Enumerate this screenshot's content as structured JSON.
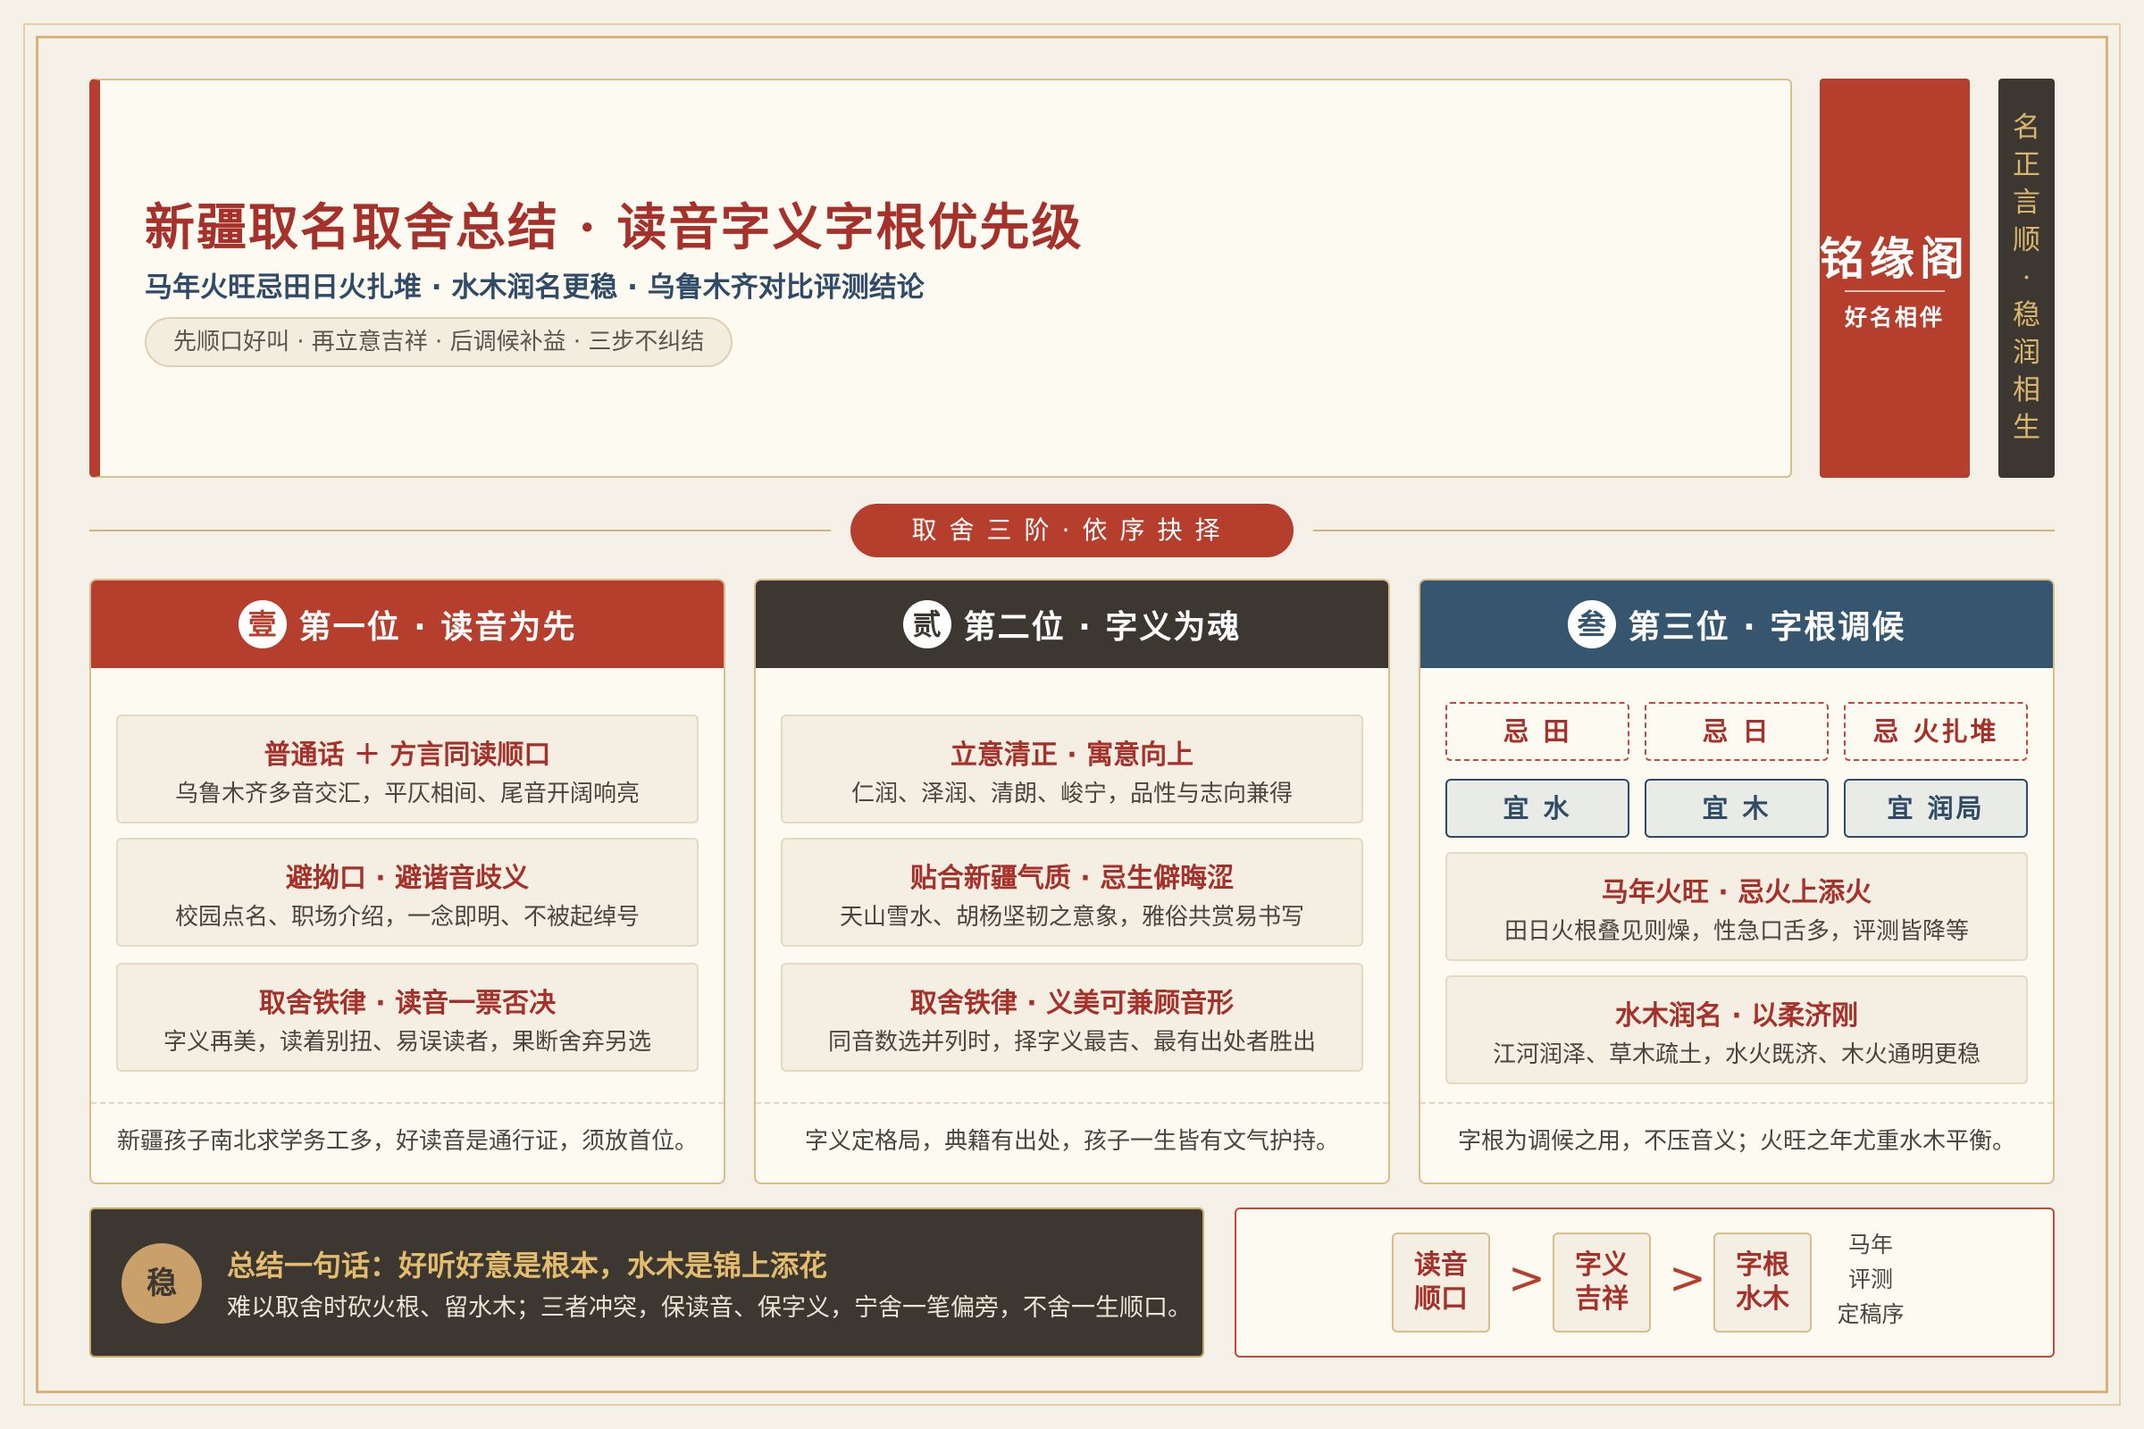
{
  "header": {
    "title": "新疆取名取舍总结 · 读音字义字根优先级",
    "subtitle": "马年火旺忌田日火扎堆 · 水木润名更稳 · 乌鲁木齐对比评测结论",
    "pill": "先顺口好叫 · 再立意吉祥 · 后调候补益 · 三步不纠结"
  },
  "seal": {
    "name": "铭缘阁",
    "slogan": "好名相伴"
  },
  "vertical_banner": [
    "名",
    "正",
    "言",
    "顺",
    "·",
    "稳",
    "润",
    "相",
    "生"
  ],
  "section": {
    "label": "取舍三阶·依序抉择"
  },
  "columns": [
    {
      "badge": "壹",
      "title": "第一位 · 读音为先",
      "color": "#b63e2c",
      "cards": [
        {
          "title": "普通话 ＋ 方言同读顺口",
          "desc": "乌鲁木齐多音交汇，平仄相间、尾音开阔响亮"
        },
        {
          "title": "避拗口 · 避谐音歧义",
          "desc": "校园点名、职场介绍，一念即明、不被起绰号"
        },
        {
          "title": "取舍铁律 · 读音一票否决",
          "desc": "字义再美，读着别扭、易误读者，果断舍弃另选"
        }
      ],
      "footer": "新疆孩子南北求学务工多，好读音是通行证，须放首位。"
    },
    {
      "badge": "贰",
      "title": "第二位 · 字义为魂",
      "color": "#3c3731",
      "cards": [
        {
          "title": "立意清正 · 寓意向上",
          "desc": "仁润、泽润、清朗、峻宁，品性与志向兼得"
        },
        {
          "title": "贴合新疆气质 · 忌生僻晦涩",
          "desc": "天山雪水、胡杨坚韧之意象，雅俗共赏易书写"
        },
        {
          "title": "取舍铁律 · 义美可兼顾音形",
          "desc": "同音数选并列时，择字义最吉、最有出处者胜出"
        }
      ],
      "footer": "字义定格局，典籍有出处，孩子一生皆有文气护持。"
    },
    {
      "badge": "叁",
      "title": "第三位 · 字根调候",
      "color": "#36566f",
      "avoid_tags": [
        "忌 田",
        "忌 日",
        "忌 火扎堆"
      ],
      "prefer_tags": [
        "宜 水",
        "宜 木",
        "宜 润局"
      ],
      "cards": [
        {
          "title": "马年火旺 · 忌火上添火",
          "desc": "田日火根叠见则燥，性急口舌多，评测皆降等"
        },
        {
          "title": "水木润名 · 以柔济刚",
          "desc": "江河润泽、草木疏土，水火既济、木火通明更稳"
        }
      ],
      "footer": "字根为调候之用，不压音义；火旺之年尤重水木平衡。"
    }
  ],
  "summary": {
    "badge": "稳",
    "title": "总结一句话：好听好意是根本，水木是锦上添花",
    "text": "难以取舍时砍火根、留水木；三者冲突，保读音、保字义，宁舍一笔偏旁，不舍一生顺口。"
  },
  "order": {
    "items": [
      "读音顺口",
      "字义吉祥",
      "字根水木"
    ],
    "items_lines": [
      [
        "读音",
        "顺口"
      ],
      [
        "字义",
        "吉祥"
      ],
      [
        "字根",
        "水木"
      ]
    ],
    "separator": ">",
    "note": [
      "马年",
      "评测",
      "定稿序"
    ]
  }
}
